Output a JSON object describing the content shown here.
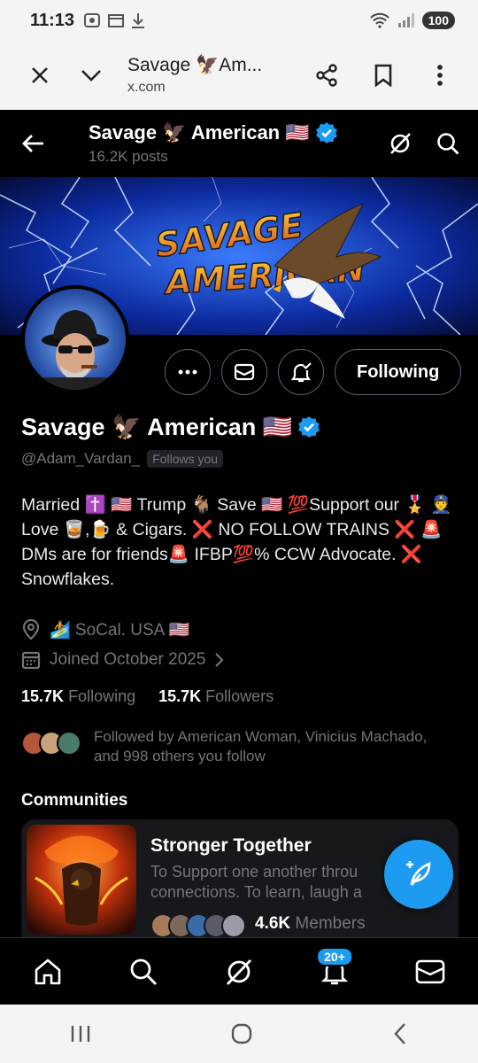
{
  "status_bar": {
    "time": "11:13",
    "battery": "100"
  },
  "browser": {
    "title": "Savage 🦅Am...",
    "url": "x.com"
  },
  "header": {
    "name": "Savage 🦅 American 🇺🇸",
    "posts": "16.2K posts"
  },
  "profile": {
    "name": "Savage 🦅 American 🇺🇸",
    "handle": "@Adam_Vardan_",
    "follows_you": "Follows you",
    "bio": "Married ✝️ 🇺🇸 Trump 🐐 Save 🇺🇸 💯Support our 🎖️ 👮 Love 🥃,🍺 & Cigars. ❌ NO FOLLOW TRAINS ❌ 🚨DMs are for friends🚨 IFBP💯% CCW Advocate. ❌ Snowflakes.",
    "location": "🏄 SoCal. USA 🇺🇸",
    "joined": "Joined October 2025",
    "following_count": "15.7K",
    "following_label": "Following",
    "followers_count": "15.7K",
    "followers_label": "Followers",
    "followed_by": "Followed by American Woman, Vinicius Machado, and 998 others you follow"
  },
  "action_buttons": {
    "following_label": "Following"
  },
  "communities": {
    "title": "Communities",
    "card": {
      "name": "Stronger Together",
      "description_line1": "To Support one another throu",
      "description_line2": "connections. To learn, laugh a",
      "members_count": "4.6K",
      "members_label": "Members"
    }
  },
  "bottom_nav": {
    "notifications_badge": "20+"
  },
  "colors": {
    "accent": "#1d9bf0",
    "background": "#000000",
    "muted": "#71767b"
  }
}
